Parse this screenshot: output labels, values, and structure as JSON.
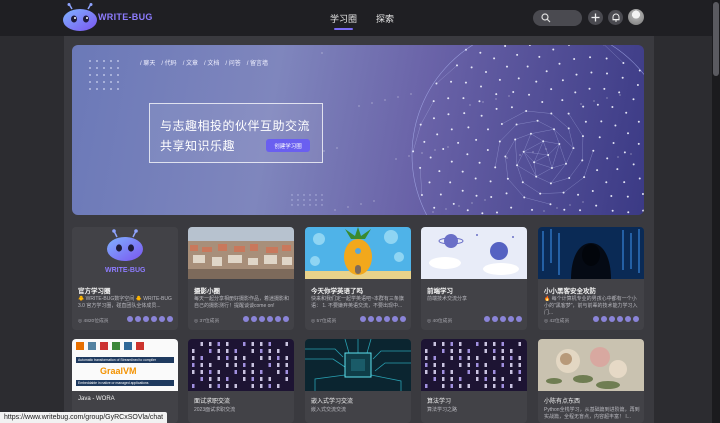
{
  "header": {
    "logo_text": "WRITE-BUG",
    "nav": [
      {
        "label": "学习圈"
      },
      {
        "label": "探索"
      }
    ]
  },
  "banner": {
    "tags": [
      "/ 聊天",
      "/ 代码",
      "/ 文章",
      "/ 文档",
      "/ 问答",
      "/ 留言墙"
    ],
    "slogan_line1": "与志趣相投的伙伴互助交流",
    "slogan_line2": "共享知识乐趣",
    "create_button": "创建学习圈"
  },
  "cards": [
    {
      "title": "官方学习圈",
      "desc": "🐥 WRITE-BUG数字空间 🐥 WRITE-BUG 3.0 官方学习圈，碰直团队全体成员...",
      "members": "4820位成员"
    },
    {
      "title": "摄影小圈",
      "desc": "每天一起分享相册好摄影作品，着迷摄影和自己的摄影测行！提醒谈谈come on!",
      "members": "37位成员"
    },
    {
      "title": "今天你学英语了吗",
      "desc": "快来和我们定一起学英语吧~本群有三条旗语： 1. 不要嫌弃英语交流，不要出现中...",
      "members": "57位成员"
    },
    {
      "title": "前端学习",
      "desc": "前端技术交流分享",
      "members": "40位成员"
    },
    {
      "title": "小小黑客安全攻防",
      "desc": "🔥 每个计算机专业的男孩心中都有一个小小的\"黑客梦\"，前与前辈的技术能力学习入门...",
      "members": "42位成员"
    }
  ],
  "cards_row2": [
    {
      "title": "Java - WORA",
      "desc": ""
    },
    {
      "title": "面试求职交流",
      "desc": "2023面试求职交流"
    },
    {
      "title": "嵌入式学习交流",
      "desc": "嵌入式交流交流"
    },
    {
      "title": "算法学习",
      "desc": "算法学习之路"
    },
    {
      "title": "小陈有点东西",
      "desc": "Python全栈学习，从基础篇到进阶篇，再到实战篇，全程无盲点，内容超丰富！ I..."
    }
  ],
  "java_thumb": {
    "line1": "Automatic transformation of Streamlined to compiler",
    "brand": "GraalVM",
    "line2": "Embeddable in native or managed applications"
  },
  "status_url": "https://www.writebug.com/group/GyRCxSOVla/chat",
  "colors": {
    "accent": "#7b6cf6",
    "button": "#6a5ff0",
    "card_bg": "#424247",
    "page_bg": "#2c2c30"
  },
  "icons": [
    "search-icon",
    "plus-icon",
    "bell-icon",
    "user-avatar",
    "bug-mascot-icon",
    "member-icon"
  ]
}
